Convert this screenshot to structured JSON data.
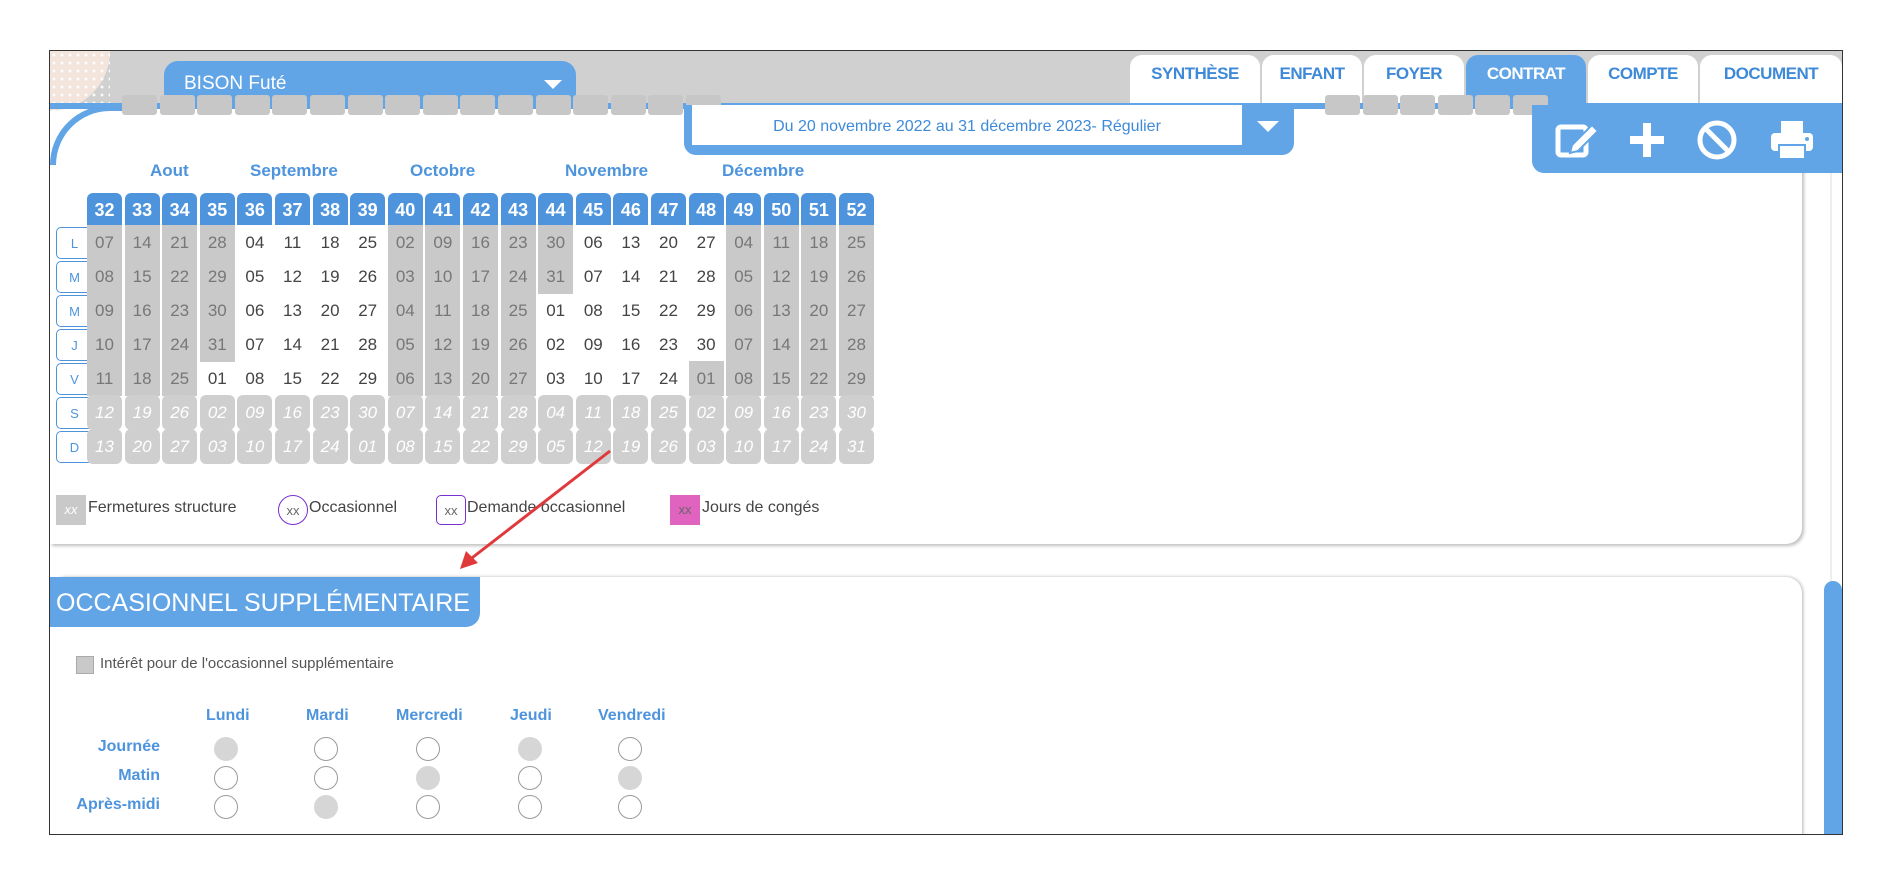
{
  "header": {
    "child_select_value": "BISON Futé",
    "tabs": [
      {
        "label": "SYNTHÈSE",
        "active": false
      },
      {
        "label": "ENFANT",
        "active": false
      },
      {
        "label": "FOYER",
        "active": false
      },
      {
        "label": "CONTRAT",
        "active": true
      },
      {
        "label": "COMPTE",
        "active": false
      },
      {
        "label": "DOCUMENT",
        "active": false
      }
    ]
  },
  "contract_period": "Du 20 novembre 2022 au 31 décembre 2023- Régulier",
  "toolbar": {
    "icons": [
      "edit-icon",
      "plus-icon",
      "cancel-icon",
      "print-icon"
    ]
  },
  "calendar": {
    "months": [
      "Aout",
      "Septembre",
      "Octobre",
      "Novembre",
      "Décembre"
    ],
    "weeks": [
      "32",
      "33",
      "34",
      "35",
      "36",
      "37",
      "38",
      "39",
      "40",
      "41",
      "42",
      "43",
      "44",
      "45",
      "46",
      "47",
      "48",
      "49",
      "50",
      "51",
      "52"
    ],
    "day_labels": [
      "L",
      "M",
      "M",
      "J",
      "V",
      "S",
      "D"
    ],
    "rows": [
      [
        "07",
        "14",
        "21",
        "28",
        "04",
        "11",
        "18",
        "25",
        "02",
        "09",
        "16",
        "23",
        "30",
        "06",
        "13",
        "20",
        "27",
        "04",
        "11",
        "18",
        "25"
      ],
      [
        "08",
        "15",
        "22",
        "29",
        "05",
        "12",
        "19",
        "26",
        "03",
        "10",
        "17",
        "24",
        "31",
        "07",
        "14",
        "21",
        "28",
        "05",
        "12",
        "19",
        "26"
      ],
      [
        "09",
        "16",
        "23",
        "30",
        "06",
        "13",
        "20",
        "27",
        "04",
        "11",
        "18",
        "25",
        "01",
        "08",
        "15",
        "22",
        "29",
        "06",
        "13",
        "20",
        "27"
      ],
      [
        "10",
        "17",
        "24",
        "31",
        "07",
        "14",
        "21",
        "28",
        "05",
        "12",
        "19",
        "26",
        "02",
        "09",
        "16",
        "23",
        "30",
        "07",
        "14",
        "21",
        "28"
      ],
      [
        "11",
        "18",
        "25",
        "01",
        "08",
        "15",
        "22",
        "29",
        "06",
        "13",
        "20",
        "27",
        "03",
        "10",
        "17",
        "24",
        "01",
        "08",
        "15",
        "22",
        "29"
      ],
      [
        "12",
        "19",
        "26",
        "02",
        "09",
        "16",
        "23",
        "30",
        "07",
        "14",
        "21",
        "28",
        "04",
        "11",
        "18",
        "25",
        "02",
        "09",
        "16",
        "23",
        "30"
      ],
      [
        "13",
        "20",
        "27",
        "03",
        "10",
        "17",
        "24",
        "01",
        "08",
        "15",
        "22",
        "29",
        "05",
        "12",
        "19",
        "26",
        "03",
        "10",
        "17",
        "24",
        "31"
      ]
    ],
    "legend": [
      {
        "swatch": "xx",
        "label": "Fermetures structure"
      },
      {
        "swatch": "xx",
        "label": "Occasionnel"
      },
      {
        "swatch": "xx",
        "label": "Demande occasionnel"
      },
      {
        "swatch": "xx",
        "label": "Jours de congés"
      }
    ]
  },
  "occasional": {
    "title": "OCCASIONNEL SUPPLÉMENTAIRE",
    "interest_label": "Intérêt pour de l'occasionnel supplémentaire",
    "days": [
      "Lundi",
      "Mardi",
      "Mercredi",
      "Jeudi",
      "Vendredi"
    ],
    "periods": [
      {
        "label": "Journée",
        "selected": [
          true,
          false,
          false,
          true,
          false
        ]
      },
      {
        "label": "Matin",
        "selected": [
          false,
          false,
          true,
          false,
          true
        ]
      },
      {
        "label": "Après-midi",
        "selected": [
          false,
          true,
          false,
          false,
          false
        ]
      }
    ]
  },
  "colors": {
    "accent": "#62a5e6",
    "accent_dark": "#4e94dd",
    "closure": "#c9c9c9",
    "leave": "#e063c0",
    "arrow": "#e0393b"
  }
}
